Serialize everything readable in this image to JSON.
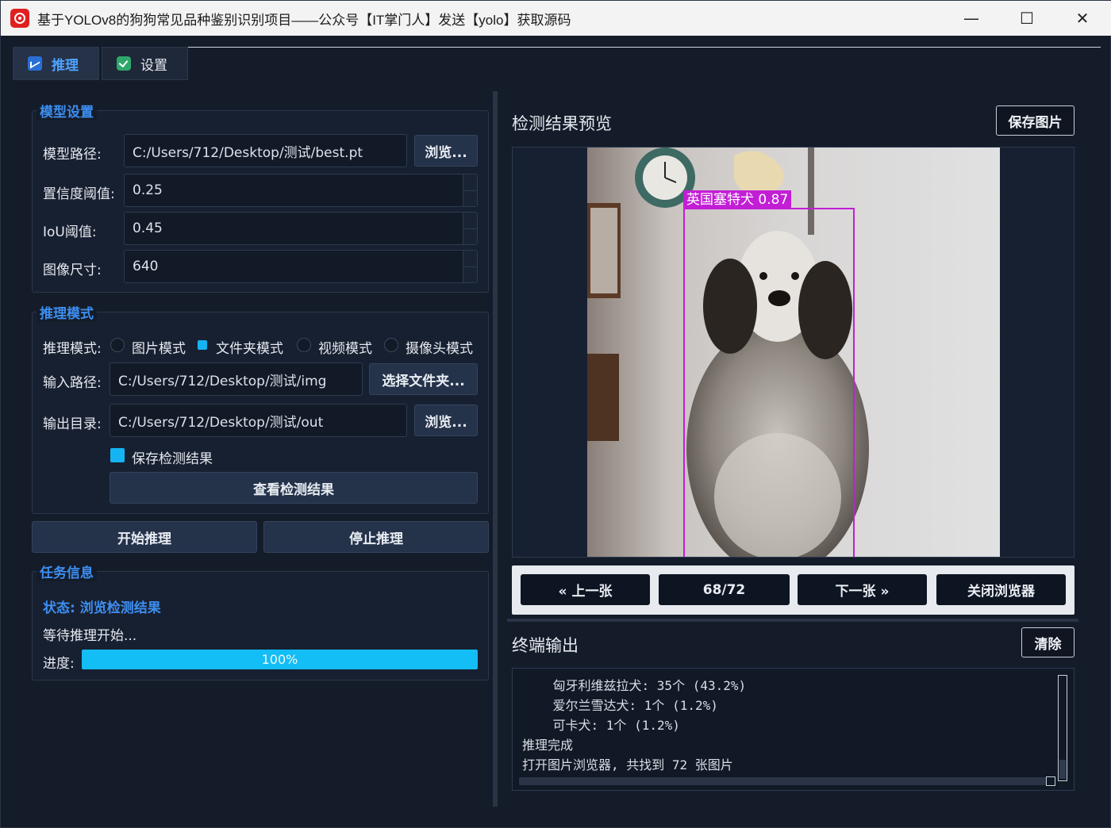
{
  "window": {
    "title": "基于YOLOv8的狗狗常见品种鉴别识别项目——公众号【IT掌门人】发送【yolo】获取源码"
  },
  "tabs": [
    {
      "label": "推理"
    },
    {
      "label": "设置"
    }
  ],
  "model_settings": {
    "title": "模型设置",
    "model_path_label": "模型路径:",
    "model_path": "C:/Users/712/Desktop/测试/best.pt",
    "browse": "浏览...",
    "confidence_label": "置信度阈值:",
    "confidence": "0.25",
    "iou_label": "IoU阈值:",
    "iou": "0.45",
    "image_size_label": "图像尺寸:",
    "image_size": "640"
  },
  "inference_mode": {
    "title": "推理模式",
    "mode_label": "推理模式:",
    "modes": [
      {
        "label": "图片模式",
        "checked": false
      },
      {
        "label": "文件夹模式",
        "checked": true
      },
      {
        "label": "视频模式",
        "checked": false
      },
      {
        "label": "摄像头模式",
        "checked": false
      }
    ],
    "input_label": "输入路径:",
    "input_path": "C:/Users/712/Desktop/测试/img",
    "select_folder": "选择文件夹...",
    "output_label": "输出目录:",
    "output_path": "C:/Users/712/Desktop/测试/out",
    "browse": "浏览...",
    "save_results_label": "保存检测结果",
    "save_results_checked": true,
    "view_results": "查看检测结果"
  },
  "actions": {
    "start": "开始推理",
    "stop": "停止推理"
  },
  "task_info": {
    "title": "任务信息",
    "status": "状态: 浏览检测结果",
    "message": "等待推理开始...",
    "progress_label": "进度:",
    "progress_percent": 100,
    "progress_text": "100%"
  },
  "preview": {
    "title": "检测结果预览",
    "save_image": "保存图片",
    "detection_label": "英国塞特犬 0.87",
    "prev": "« 上一张",
    "counter": "68/72",
    "next": "下一张 »",
    "close": "关闭浏览器"
  },
  "terminal": {
    "title": "终端输出",
    "clear": "清除",
    "lines": [
      "    匈牙利维兹拉犬: 35个 (43.2%)",
      "    爱尔兰雪达犬: 1个 (1.2%)",
      "    可卡犬: 1个 (1.2%)",
      "推理完成",
      "打开图片浏览器, 共找到 72 张图片"
    ]
  },
  "colors": {
    "accent": "#3d8ef0",
    "progress": "#13bdf5",
    "bbox": "#c21ed6",
    "background": "#141c2a"
  }
}
